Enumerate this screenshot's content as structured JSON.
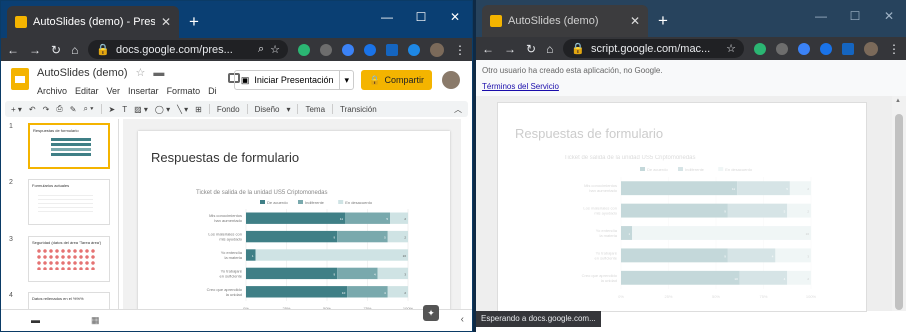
{
  "left_window": {
    "tab_title": "AutoSlides (demo) - Presentacion...",
    "url": "docs.google.com/pres...",
    "doc_title": "AutoSlides (demo)",
    "menus": [
      "Archivo",
      "Editar",
      "Ver",
      "Insertar",
      "Formato",
      "Di"
    ],
    "present_label": "Iniciar Presentación",
    "share_label": "Compartir",
    "edit_toolbar": [
      "Fondo",
      "Diseño",
      "Tema",
      "Transición"
    ],
    "thumbnails": [
      {
        "num": "1",
        "title": "Respuestas de formulario"
      },
      {
        "num": "2",
        "title": "Formularios actuales"
      },
      {
        "num": "3",
        "title": "Seguridad (datos del área 'Tarea área')"
      },
      {
        "num": "4",
        "title": "Datos rellenados en el %%%"
      }
    ],
    "slide_title": "Respuestas de formulario"
  },
  "right_window": {
    "tab_title": "AutoSlides (demo)",
    "url": "script.google.com/mac...",
    "notice": "Otro usuario ha creado esta aplicación, no Google.",
    "terms_link": "Términos del Servicio",
    "slide_title": "Respuestas de formulario",
    "status_text": "Esperando a docs.google.com..."
  },
  "chart_data": {
    "type": "bar",
    "title": "Ticket de salida de la unidad US5 Criptomonedas",
    "legend": [
      "De acuerdo",
      "Indiferente",
      "En desacuerdo"
    ],
    "categories": [
      "Mis conocimientos han aumentado",
      "Los materiales con mis ayudado",
      "Yo entendía la materia",
      "Yo trabajaré en suficiente",
      "Creo que aprendido la unidad"
    ],
    "series": [
      {
        "name": "De acuerdo",
        "values": [
          11,
          9,
          1,
          9,
          10
        ]
      },
      {
        "name": "Indiferente",
        "values": [
          5,
          5,
          0,
          4,
          4
        ]
      },
      {
        "name": "En desacuerdo",
        "values": [
          2,
          2,
          16,
          3,
          2
        ]
      }
    ],
    "xticks": [
      "0%",
      "25%",
      "50%",
      "75%",
      "100%"
    ],
    "colors": [
      "#3f7f86",
      "#79a9ad",
      "#cfe3e4"
    ]
  }
}
